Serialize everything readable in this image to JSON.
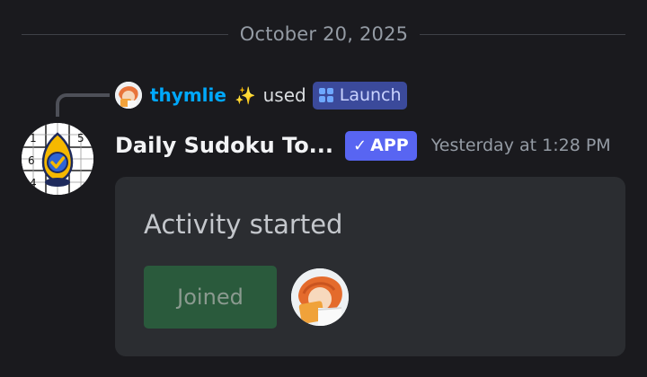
{
  "divider": {
    "date": "October 20, 2025"
  },
  "reply": {
    "username": "thymlie",
    "sparkle": "✨",
    "used": "used",
    "command": "Launch",
    "command_icon": "activity-rocket-icon"
  },
  "message": {
    "app_name": "Daily Sudoku To...",
    "badge": "APP",
    "badge_check": "✓",
    "timestamp": "Yesterday at 1:28 PM"
  },
  "card": {
    "title": "Activity started",
    "button_label": "Joined"
  },
  "sudoku_digits": [
    "1",
    "5",
    "6",
    "4"
  ],
  "colors": {
    "username": "#00a8fc",
    "badge": "#5865f2",
    "button": "#2a5a3c",
    "card": "#2b2d31",
    "background": "#1a1a1e"
  }
}
